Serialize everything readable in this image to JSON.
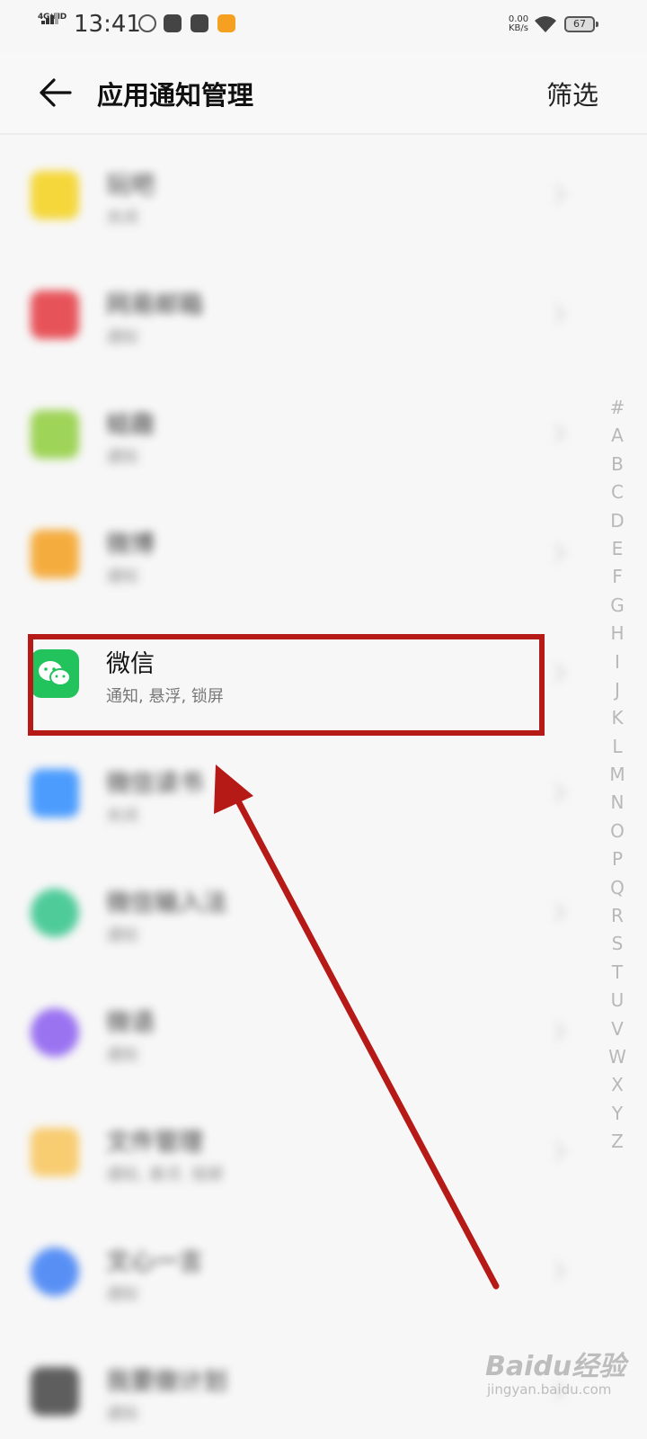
{
  "status_bar": {
    "network": "4G⁺HD",
    "time": "13:41",
    "speed_value": "0.00",
    "speed_unit": "KB/s",
    "battery": "67"
  },
  "header": {
    "title": "应用通知管理",
    "filter_label": "筛选",
    "back_icon": "arrow-left-icon"
  },
  "apps": [
    {
      "name": "玩吧",
      "status": "关闭",
      "icon_color": "#f5d21b"
    },
    {
      "name": "网易邮箱",
      "status": "通知",
      "icon_color": "#e4383f"
    },
    {
      "name": "蛙趣",
      "status": "通知",
      "icon_color": "#8fce3c"
    },
    {
      "name": "微博",
      "status": "通知",
      "icon_color": "#f5a020"
    },
    {
      "name": "微信",
      "status": "通知, 悬浮, 锁屏",
      "icon_color": "#22c35d"
    },
    {
      "name": "微信读书",
      "status": "关闭",
      "icon_color": "#2f8dff"
    },
    {
      "name": "微信输入法",
      "status": "通知",
      "icon_color": "#32c48a"
    },
    {
      "name": "微语",
      "status": "通知",
      "icon_color": "#8a5cf0"
    },
    {
      "name": "文件管理",
      "status": "通知, 悬浮, 锁屏",
      "icon_color": "#f9c55a"
    },
    {
      "name": "文心一言",
      "status": "通知",
      "icon_color": "#3d7ef5"
    },
    {
      "name": "我要做计划",
      "status": "通知",
      "icon_color": "#444444"
    }
  ],
  "alphabet_index": [
    "#",
    "A",
    "B",
    "C",
    "D",
    "E",
    "F",
    "G",
    "H",
    "I",
    "J",
    "K",
    "L",
    "M",
    "N",
    "O",
    "P",
    "Q",
    "R",
    "S",
    "T",
    "U",
    "V",
    "W",
    "X",
    "Y",
    "Z"
  ],
  "annotation": {
    "color": "#b51a17",
    "highlighted_app": "微信"
  },
  "watermark": {
    "logo": "Baidu经验",
    "url": "jingyan.baidu.com"
  }
}
